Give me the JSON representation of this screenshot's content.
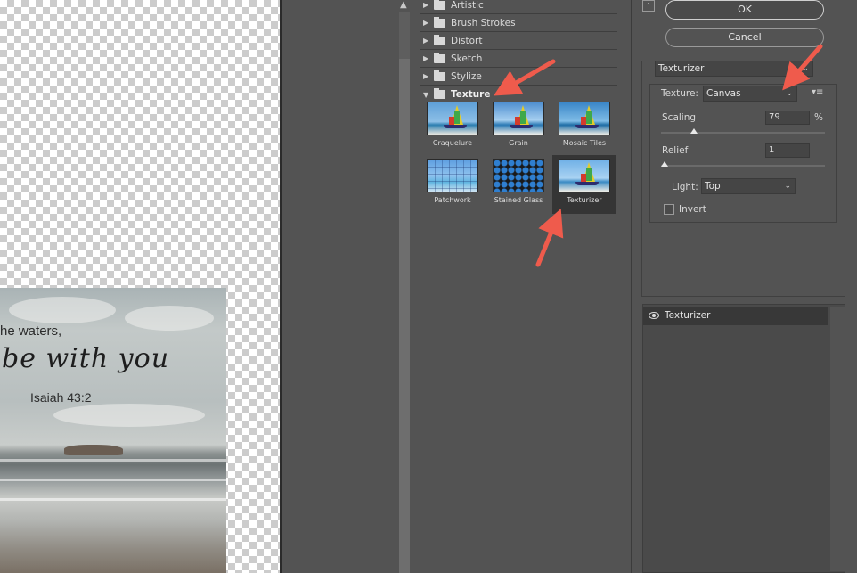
{
  "preview": {
    "verse_line1": "he waters,",
    "verse_line2": "be with you",
    "verse_ref": "Isaiah 43:2"
  },
  "gallery": {
    "categories": [
      {
        "label": "Artistic",
        "state": "collapsed"
      },
      {
        "label": "Brush Strokes",
        "state": "collapsed"
      },
      {
        "label": "Distort",
        "state": "collapsed"
      },
      {
        "label": "Sketch",
        "state": "collapsed"
      },
      {
        "label": "Stylize",
        "state": "collapsed"
      },
      {
        "label": "Texture",
        "state": "expanded"
      }
    ],
    "texture_filters": [
      {
        "name": "Craquelure"
      },
      {
        "name": "Grain"
      },
      {
        "name": "Mosaic Tiles"
      },
      {
        "name": "Patchwork"
      },
      {
        "name": "Stained Glass"
      },
      {
        "name": "Texturizer",
        "selected": true
      }
    ]
  },
  "buttons": {
    "ok": "OK",
    "cancel": "Cancel"
  },
  "settings": {
    "filter_select": "Texturizer",
    "texture_label": "Texture:",
    "texture_value": "Canvas",
    "scaling_label": "Scaling",
    "scaling_value": "79",
    "scaling_unit": "%",
    "scaling_fraction": 0.2,
    "relief_label": "Relief",
    "relief_value": "1",
    "relief_fraction": 0.02,
    "light_label": "Light:",
    "light_value": "Top",
    "invert_label": "Invert",
    "invert_checked": false
  },
  "layers": {
    "items": [
      {
        "name": "Texturizer"
      }
    ]
  },
  "colors": {
    "panel_bg": "#535353",
    "annotation_arrow": "#ef5b4c"
  }
}
